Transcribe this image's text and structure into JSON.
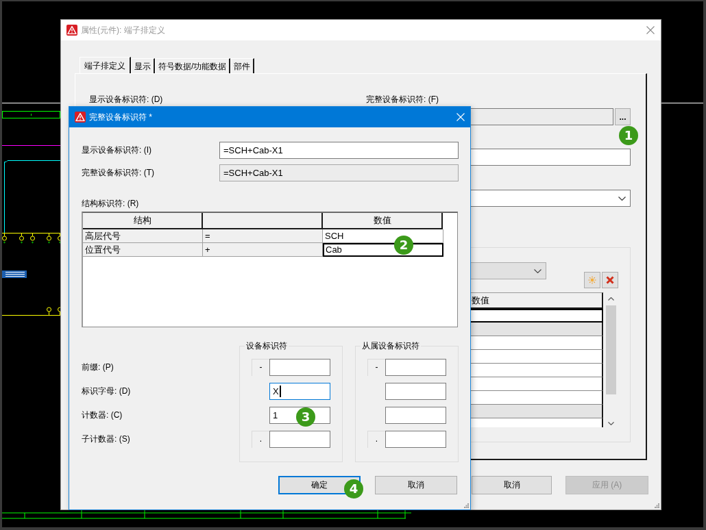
{
  "properties_dialog": {
    "title": "属性(元件): 端子排定义",
    "active": false,
    "tabs": [
      {
        "label": "端子排定义",
        "selected": true
      },
      {
        "label": "显示",
        "selected": false
      },
      {
        "label": "符号数据/功能数据",
        "selected": false
      },
      {
        "label": "部件",
        "selected": false
      }
    ],
    "field_labels": [
      "显示设备标识符: (D)",
      "完整设备标识符: (F)"
    ],
    "fields": [
      {
        "readonly": true,
        "browse_button": {
          "label": "...",
          "callout": "1"
        }
      },
      {
        "readonly": false
      }
    ],
    "dropdown": {
      "disabled": false
    },
    "property_table": {
      "dropdown": {
        "disabled": true
      },
      "columns": [
        "数值"
      ],
      "rows": [
        {
          "selected": true,
          "readonly": false
        },
        {
          "selected": false,
          "readonly": true
        },
        {
          "selected": false,
          "readonly": false
        },
        {
          "selected": false,
          "readonly": false
        },
        {
          "selected": false,
          "readonly": false
        },
        {
          "selected": false,
          "readonly": false
        },
        {
          "selected": false,
          "readonly": false
        },
        {
          "selected": false,
          "readonly": true
        },
        {
          "selected": false,
          "readonly": false
        }
      ]
    },
    "buttons": [
      {
        "label": "取消",
        "disabled": false
      },
      {
        "label": "应用 (A)",
        "disabled": true
      }
    ]
  },
  "identifier_dialog": {
    "title": "完整设备标识符 *",
    "active": true,
    "fields": [
      {
        "label": "显示设备标识符: (I)",
        "value": "=SCH+Cab-X1",
        "readonly": false
      },
      {
        "label": "完整设备标识符: (T)",
        "value": "=SCH+Cab-X1",
        "readonly": true
      }
    ],
    "structure_table": {
      "label": "结构标识符: (R)",
      "callout": "2",
      "columns": [
        {
          "label": "结构"
        },
        {},
        {
          "label": "数值"
        }
      ],
      "rows": [
        {
          "cells": [
            "高层代号",
            "=",
            "SCH"
          ],
          "selected": false
        },
        {
          "cells": [
            "位置代号",
            "+",
            "Cab"
          ],
          "selected": true
        }
      ]
    },
    "row_labels": [
      "前缀: (P)",
      "标识字母: (D)",
      "计数器: (C)",
      "子计数器: (S)"
    ],
    "identifier_groups": [
      {
        "title": "设备标识符",
        "fields": [
          {
            "prefix": "-",
            "focused": false
          },
          {
            "value": "X",
            "focused": true
          },
          {
            "value": "1",
            "focused": false,
            "callout": "3"
          },
          {
            "prefix": ".",
            "focused": false
          }
        ]
      },
      {
        "title": "从属设备标识符",
        "fields": [
          {
            "prefix": "-",
            "focused": false
          },
          {
            "focused": false
          },
          {
            "focused": false
          },
          {
            "prefix": ".",
            "focused": false
          }
        ]
      }
    ],
    "buttons": [
      {
        "label": "确定",
        "default": true,
        "callout": "4"
      },
      {
        "label": "取消",
        "default": false
      }
    ]
  }
}
